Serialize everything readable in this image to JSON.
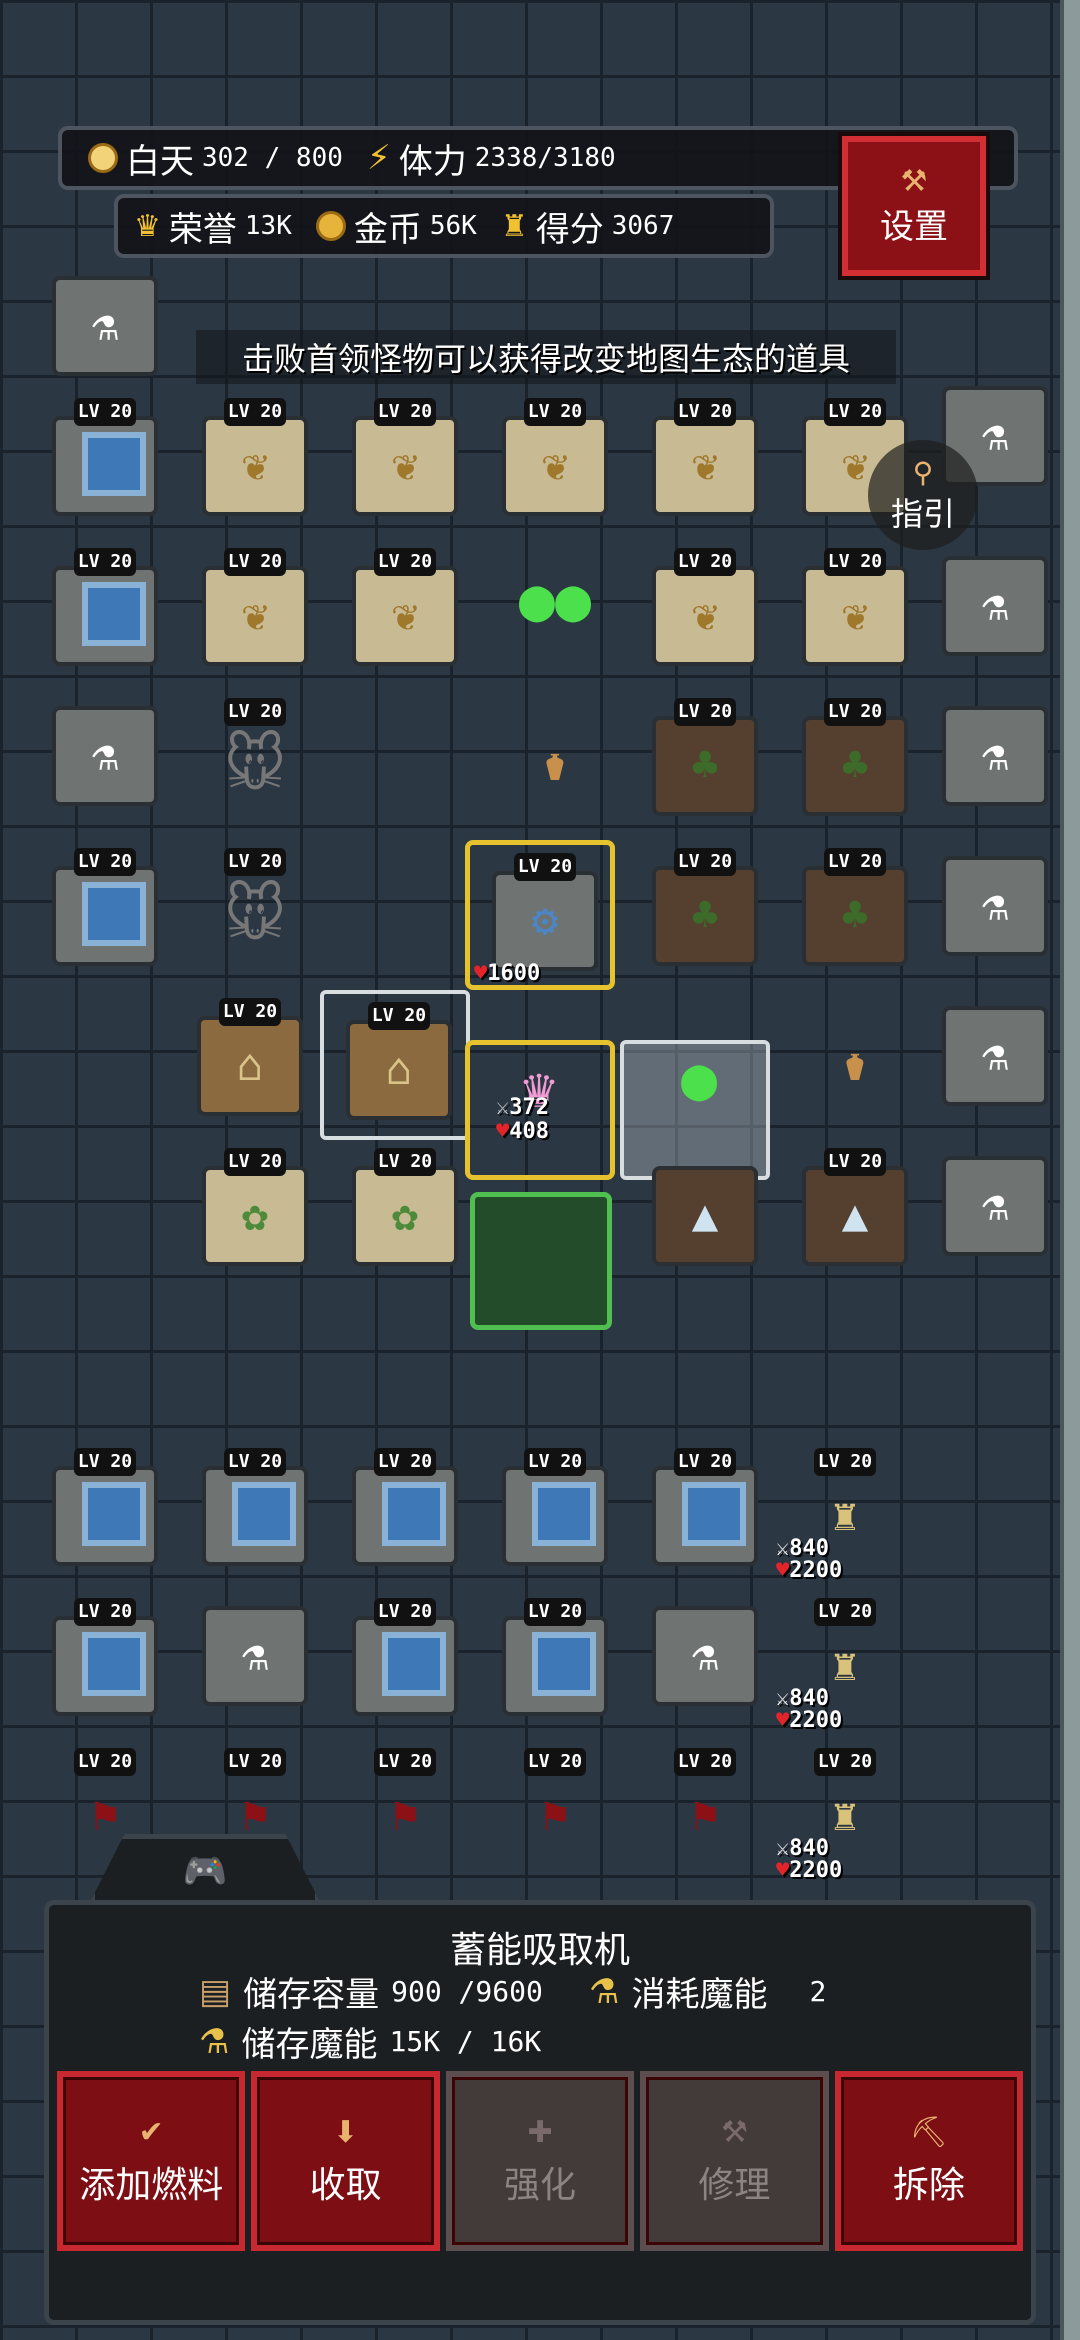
{
  "hud": {
    "day_label": "白天",
    "day_value": "302 / 800",
    "stamina_label": "体力",
    "stamina_value": "2338/3180",
    "honor_label": "荣誉",
    "honor_value": "13K",
    "gold_label": "金币",
    "gold_value": "56K",
    "score_label": "得分",
    "score_value": "3067"
  },
  "settings_label": "设置",
  "tip_banner": "击败首领怪物可以获得改变地图生态的道具",
  "guide_label": "指引",
  "level_badge": "LV 20",
  "player": {
    "attack": "372",
    "hp": "408"
  },
  "device_hp": "1600",
  "towers": [
    {
      "attack": "840",
      "hp": "2200"
    },
    {
      "attack": "840",
      "hp": "2200"
    },
    {
      "attack": "840",
      "hp": "2200"
    }
  ],
  "panel": {
    "title": "蓄能吸取机",
    "capacity_label": "储存容量",
    "capacity_value": "900 /9600",
    "consume_label": "消耗魔能",
    "consume_value": "2",
    "stored_label": "储存魔能",
    "stored_value": "15K / 16K"
  },
  "actions": [
    {
      "label": "添加燃料",
      "icon": "check-icon",
      "enabled": true
    },
    {
      "label": "收取",
      "icon": "arrow-down-icon",
      "enabled": true
    },
    {
      "label": "强化",
      "icon": "plus-icon",
      "enabled": false
    },
    {
      "label": "修理",
      "icon": "hammer-icon",
      "enabled": false
    },
    {
      "label": "拆除",
      "icon": "pickaxe-icon",
      "enabled": true
    }
  ],
  "colors": {
    "action_red": "#7c0e14",
    "action_border": "#c8282f",
    "disabled": "#433a3a",
    "accent_gold": "#f2c132",
    "selection_yellow": "#e6c22e",
    "selection_green": "#4fbf4f"
  }
}
